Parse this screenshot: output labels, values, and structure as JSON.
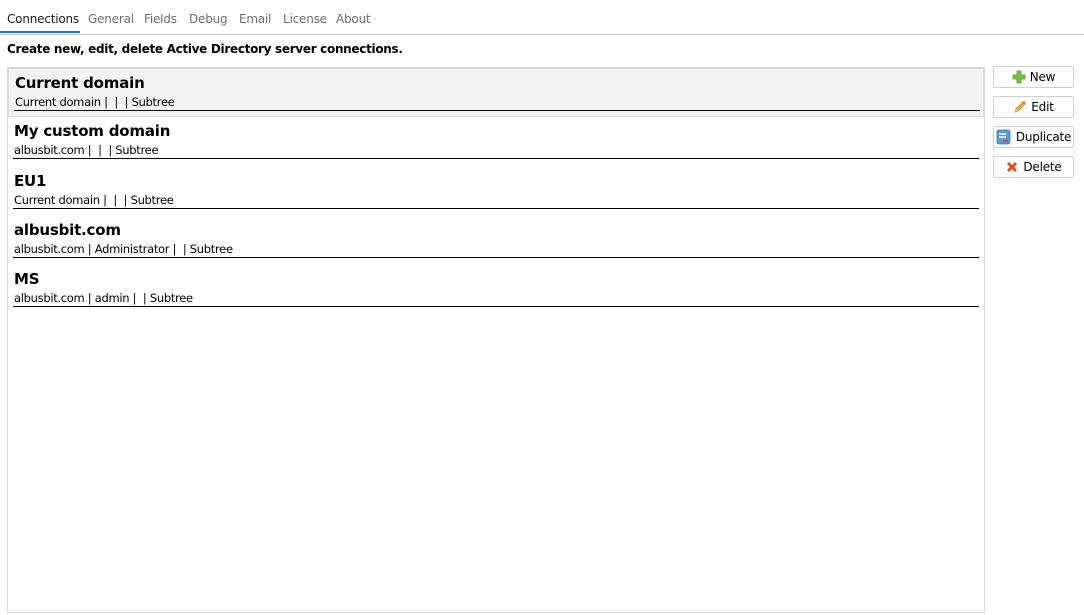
{
  "tabs": [
    {
      "label": "Connections",
      "active": true
    },
    {
      "label": "General"
    },
    {
      "label": "Fields"
    },
    {
      "label": "Debug"
    },
    {
      "label": "Email"
    },
    {
      "label": "License"
    },
    {
      "label": "About"
    }
  ],
  "description": "Create new, edit, delete Active Directory server connections.",
  "connections": [
    {
      "title": "Current domain",
      "details": "Current domain |  |  | Subtree",
      "selected": true
    },
    {
      "title": "My custom domain",
      "details": "albusbit.com |  |  | Subtree"
    },
    {
      "title": "EU1",
      "details": "Current domain |  |  | Subtree"
    },
    {
      "title": "albusbit.com",
      "details": "albusbit.com | Administrator |  | Subtree"
    },
    {
      "title": "MS",
      "details": "albusbit.com | admin |  | Subtree"
    }
  ],
  "buttons": {
    "new": {
      "label": "New",
      "icon": "plus-icon"
    },
    "edit": {
      "label": "Edit",
      "icon": "pencil-icon"
    },
    "duplicate": {
      "label": "Duplicate",
      "icon": "duplicate-icon"
    },
    "delete": {
      "label": "Delete",
      "icon": "delete-x-icon"
    }
  },
  "colors": {
    "accent": "#1979ca",
    "plus": "#7cc242",
    "delete": "#e8481c"
  }
}
